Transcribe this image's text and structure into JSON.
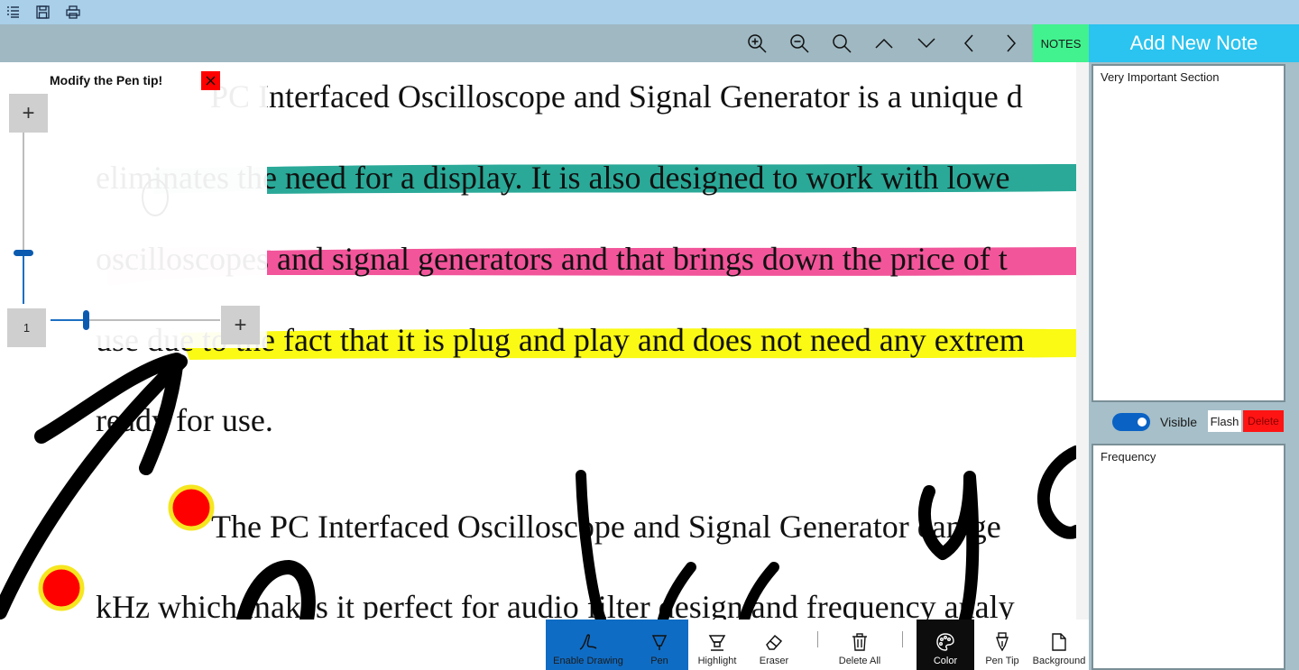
{
  "titlebar": {
    "icons": [
      "list-icon",
      "save-icon",
      "print-icon"
    ]
  },
  "doc_toolbar": {
    "icons": [
      "zoom-in-icon",
      "zoom-out-icon",
      "search-icon",
      "chevron-up-icon",
      "chevron-down-icon",
      "chevron-left-icon",
      "chevron-right-icon"
    ],
    "notes_label": "NOTES"
  },
  "notes_panel": {
    "header": "Add New Note",
    "notes": [
      {
        "text": "Very Important Section"
      },
      {
        "text": "Frequency"
      }
    ],
    "visible_label": "Visible",
    "visible_on": true,
    "flash_label": "Flash",
    "delete_label": "Delete"
  },
  "document": {
    "lines": [
      "PC Interfaced Oscilloscope and Signal Generator is a unique d",
      "eliminates the need for a display. It is also designed to work with lowe",
      "oscilloscopes and signal generators and that brings down the price of t",
      "use due to the fact that it is plug and play and does not need any extrem",
      "ready for use.",
      "The PC Interfaced Oscilloscope and Signal Generator can ge",
      "kHz which makes it perfect for audio filter design and frequency analy"
    ],
    "highlight_colors": {
      "teal": "#2aa998",
      "pink": "#f2559a",
      "yellow": "#fafa14",
      "light_teal": "#cfe9ec",
      "light_pink": "#fbd9e8",
      "ink": "#000000",
      "bullet_fill": "#ff0000",
      "bullet_ring": "#f5e620"
    }
  },
  "pen_popup": {
    "title": "Modify the Pen tip!",
    "close_label": "X",
    "plus_label": "+",
    "size_value": "1"
  },
  "bottom_toolbar": {
    "tools": [
      {
        "label": "Enable Drawing",
        "icon": "signature-icon",
        "active": true
      },
      {
        "label": "Pen",
        "icon": "pen-icon",
        "active": true
      },
      {
        "label": "Highlight",
        "icon": "highlighter-icon",
        "active": false
      },
      {
        "label": "Eraser",
        "icon": "eraser-icon",
        "active": false
      },
      {
        "label": "Delete All",
        "icon": "trash-icon",
        "active": false
      },
      {
        "label": "Color",
        "icon": "palette-icon",
        "active": true
      },
      {
        "label": "Pen Tip",
        "icon": "pen-tip-icon",
        "active": false
      },
      {
        "label": "Background",
        "icon": "page-icon",
        "active": false
      }
    ]
  }
}
